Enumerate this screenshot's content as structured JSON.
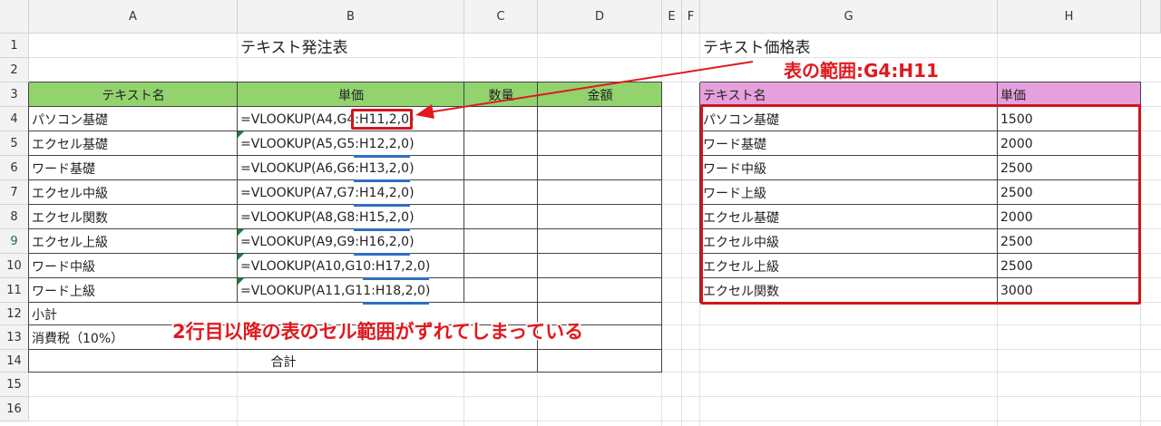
{
  "columns": [
    "A",
    "B",
    "C",
    "D",
    "E",
    "F",
    "G",
    "H"
  ],
  "rows": [
    "1",
    "2",
    "3",
    "4",
    "5",
    "6",
    "7",
    "8",
    "9",
    "10",
    "11",
    "12",
    "13",
    "14",
    "15",
    "16"
  ],
  "left_table": {
    "title": "テキスト発注表",
    "headers": [
      "テキスト名",
      "単価",
      "数量",
      "金額"
    ],
    "rows": [
      {
        "name": "パソコン基礎",
        "formula": "=VLOOKUP(A4,G4:H11,2,0)"
      },
      {
        "name": "エクセル基礎",
        "formula": "=VLOOKUP(A5,G5:H12,2,0)"
      },
      {
        "name": "ワード基礎",
        "formula": "=VLOOKUP(A6,G6:H13,2,0)"
      },
      {
        "name": "エクセル中級",
        "formula": "=VLOOKUP(A7,G7:H14,2,0)"
      },
      {
        "name": "エクセル関数",
        "formula": "=VLOOKUP(A8,G8:H15,2,0)"
      },
      {
        "name": "エクセル上級",
        "formula": "=VLOOKUP(A9,G9:H16,2,0)"
      },
      {
        "name": "ワード中級",
        "formula": "=VLOOKUP(A10,G10:H17,2,0)"
      },
      {
        "name": "ワード上級",
        "formula": "=VLOOKUP(A11,G11:H18,2,0)"
      }
    ],
    "subtotal_label": "小計",
    "tax_label": "消費税（10%）",
    "total_label": "合計"
  },
  "right_table": {
    "title": "テキスト価格表",
    "headers": [
      "テキスト名",
      "単価"
    ],
    "rows": [
      {
        "name": "パソコン基礎",
        "price": "1500"
      },
      {
        "name": "ワード基礎",
        "price": "2000"
      },
      {
        "name": "ワード中級",
        "price": "2500"
      },
      {
        "name": "ワード上級",
        "price": "2500"
      },
      {
        "name": "エクセル基礎",
        "price": "2000"
      },
      {
        "name": "エクセル中級",
        "price": "2500"
      },
      {
        "name": "エクセル上級",
        "price": "2500"
      },
      {
        "name": "エクセル関数",
        "price": "3000"
      }
    ]
  },
  "annotations": {
    "range_label": "表の範囲:G4:H11",
    "shift_note": "2行目以降の表のセル範囲がずれてしまっている"
  },
  "colors": {
    "left_header_fill": "#92d36e",
    "right_header_fill": "#e6a0de",
    "annotation_red": "#e0191e",
    "underline_blue": "#2e6fc0"
  }
}
